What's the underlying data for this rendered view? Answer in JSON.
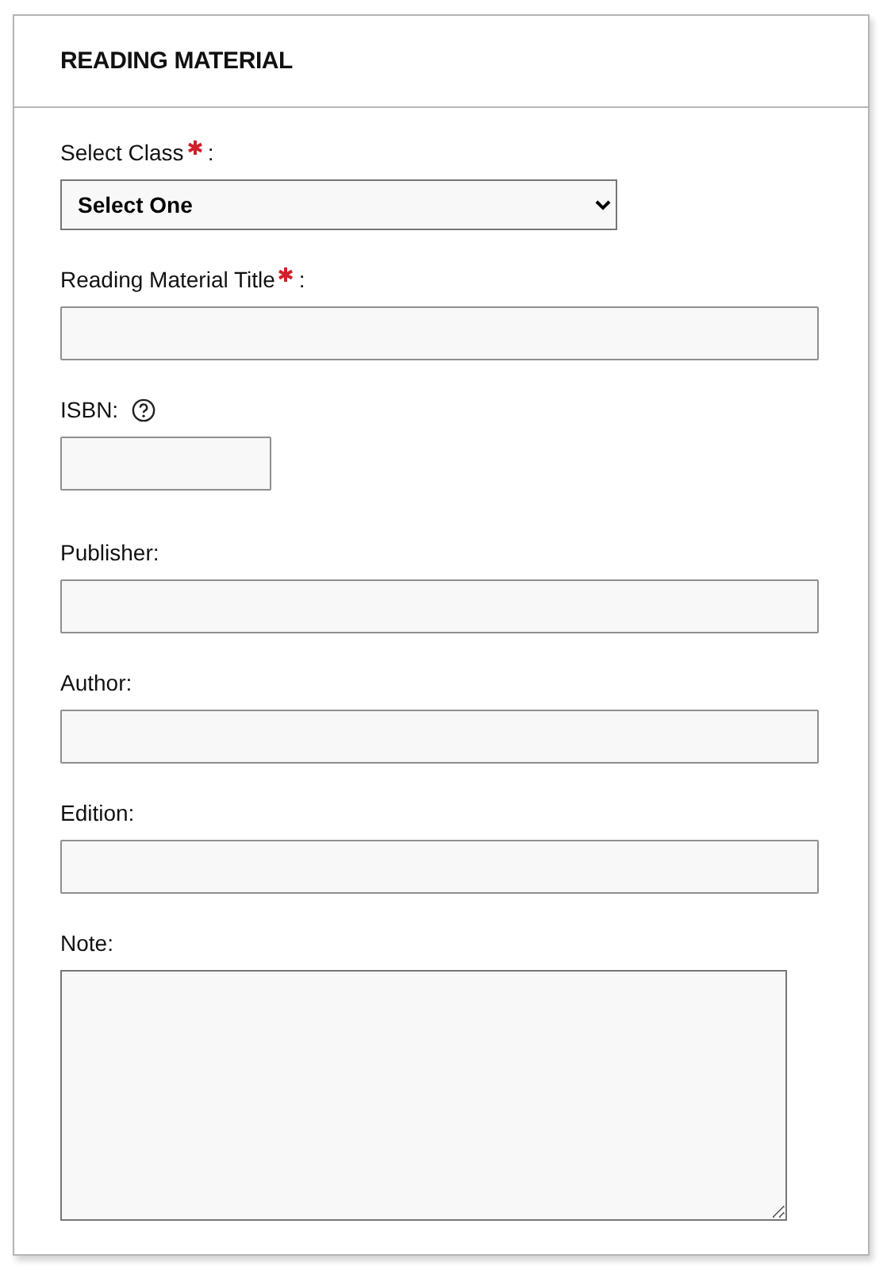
{
  "panel": {
    "title": "READING MATERIAL"
  },
  "fields": [
    {
      "kind": "select",
      "label": "Select Class",
      "required": true,
      "suffix": ":",
      "help": false,
      "value": "Select One"
    },
    {
      "kind": "text",
      "label": "Reading Material Title",
      "required": true,
      "suffix": ":",
      "help": false
    },
    {
      "kind": "short_text",
      "label": "ISBN:",
      "required": false,
      "help": true
    },
    {
      "kind": "text",
      "label": "Publisher:",
      "required": false,
      "help": false
    },
    {
      "kind": "text",
      "label": "Author:",
      "required": false,
      "help": false
    },
    {
      "kind": "text",
      "label": "Edition:",
      "required": false,
      "help": false
    },
    {
      "kind": "textarea",
      "label": "Note:",
      "required": false,
      "help": false
    }
  ]
}
